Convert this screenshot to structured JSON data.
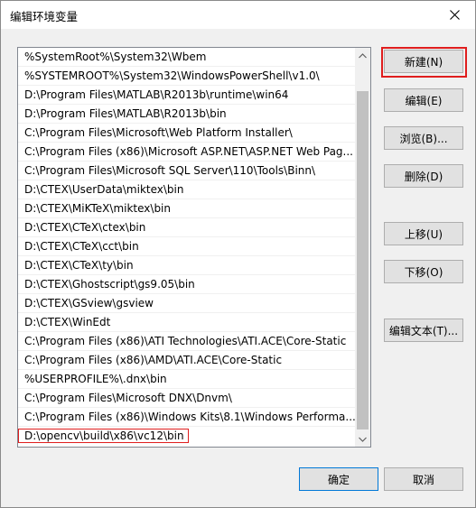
{
  "window": {
    "title": "编辑环境变量",
    "close_icon": "close-icon"
  },
  "path_list": {
    "items": [
      "%SystemRoot%\\System32\\Wbem",
      "%SYSTEMROOT%\\System32\\WindowsPowerShell\\v1.0\\",
      "D:\\Program Files\\MATLAB\\R2013b\\runtime\\win64",
      "D:\\Program Files\\MATLAB\\R2013b\\bin",
      "C:\\Program Files\\Microsoft\\Web Platform Installer\\",
      "C:\\Program Files (x86)\\Microsoft ASP.NET\\ASP.NET Web Pag...",
      "C:\\Program Files\\Microsoft SQL Server\\110\\Tools\\Binn\\",
      "D:\\CTEX\\UserData\\miktex\\bin",
      "D:\\CTEX\\MiKTeX\\miktex\\bin",
      "D:\\CTEX\\CTeX\\ctex\\bin",
      "D:\\CTEX\\CTeX\\cct\\bin",
      "D:\\CTEX\\CTeX\\ty\\bin",
      "D:\\CTEX\\Ghostscript\\gs9.05\\bin",
      "D:\\CTEX\\GSview\\gsview",
      "D:\\CTEX\\WinEdt",
      "C:\\Program Files (x86)\\ATI Technologies\\ATI.ACE\\Core-Static",
      "C:\\Program Files (x86)\\AMD\\ATI.ACE\\Core-Static",
      "%USERPROFILE%\\.dnx\\bin",
      "C:\\Program Files\\Microsoft DNX\\Dnvm\\",
      "C:\\Program Files (x86)\\Windows Kits\\8.1\\Windows Performa..."
    ],
    "editing_value": "D:\\opencv\\build\\x86\\vc12\\bin"
  },
  "buttons": {
    "new": "新建(N)",
    "edit": "编辑(E)",
    "browse": "浏览(B)...",
    "delete": "删除(D)",
    "move_up": "上移(U)",
    "move_down": "下移(O)",
    "edit_text": "编辑文本(T)...",
    "ok": "确定",
    "cancel": "取消"
  },
  "colors": {
    "highlight": "#e01e1e",
    "default_button_border": "#0078d7"
  }
}
